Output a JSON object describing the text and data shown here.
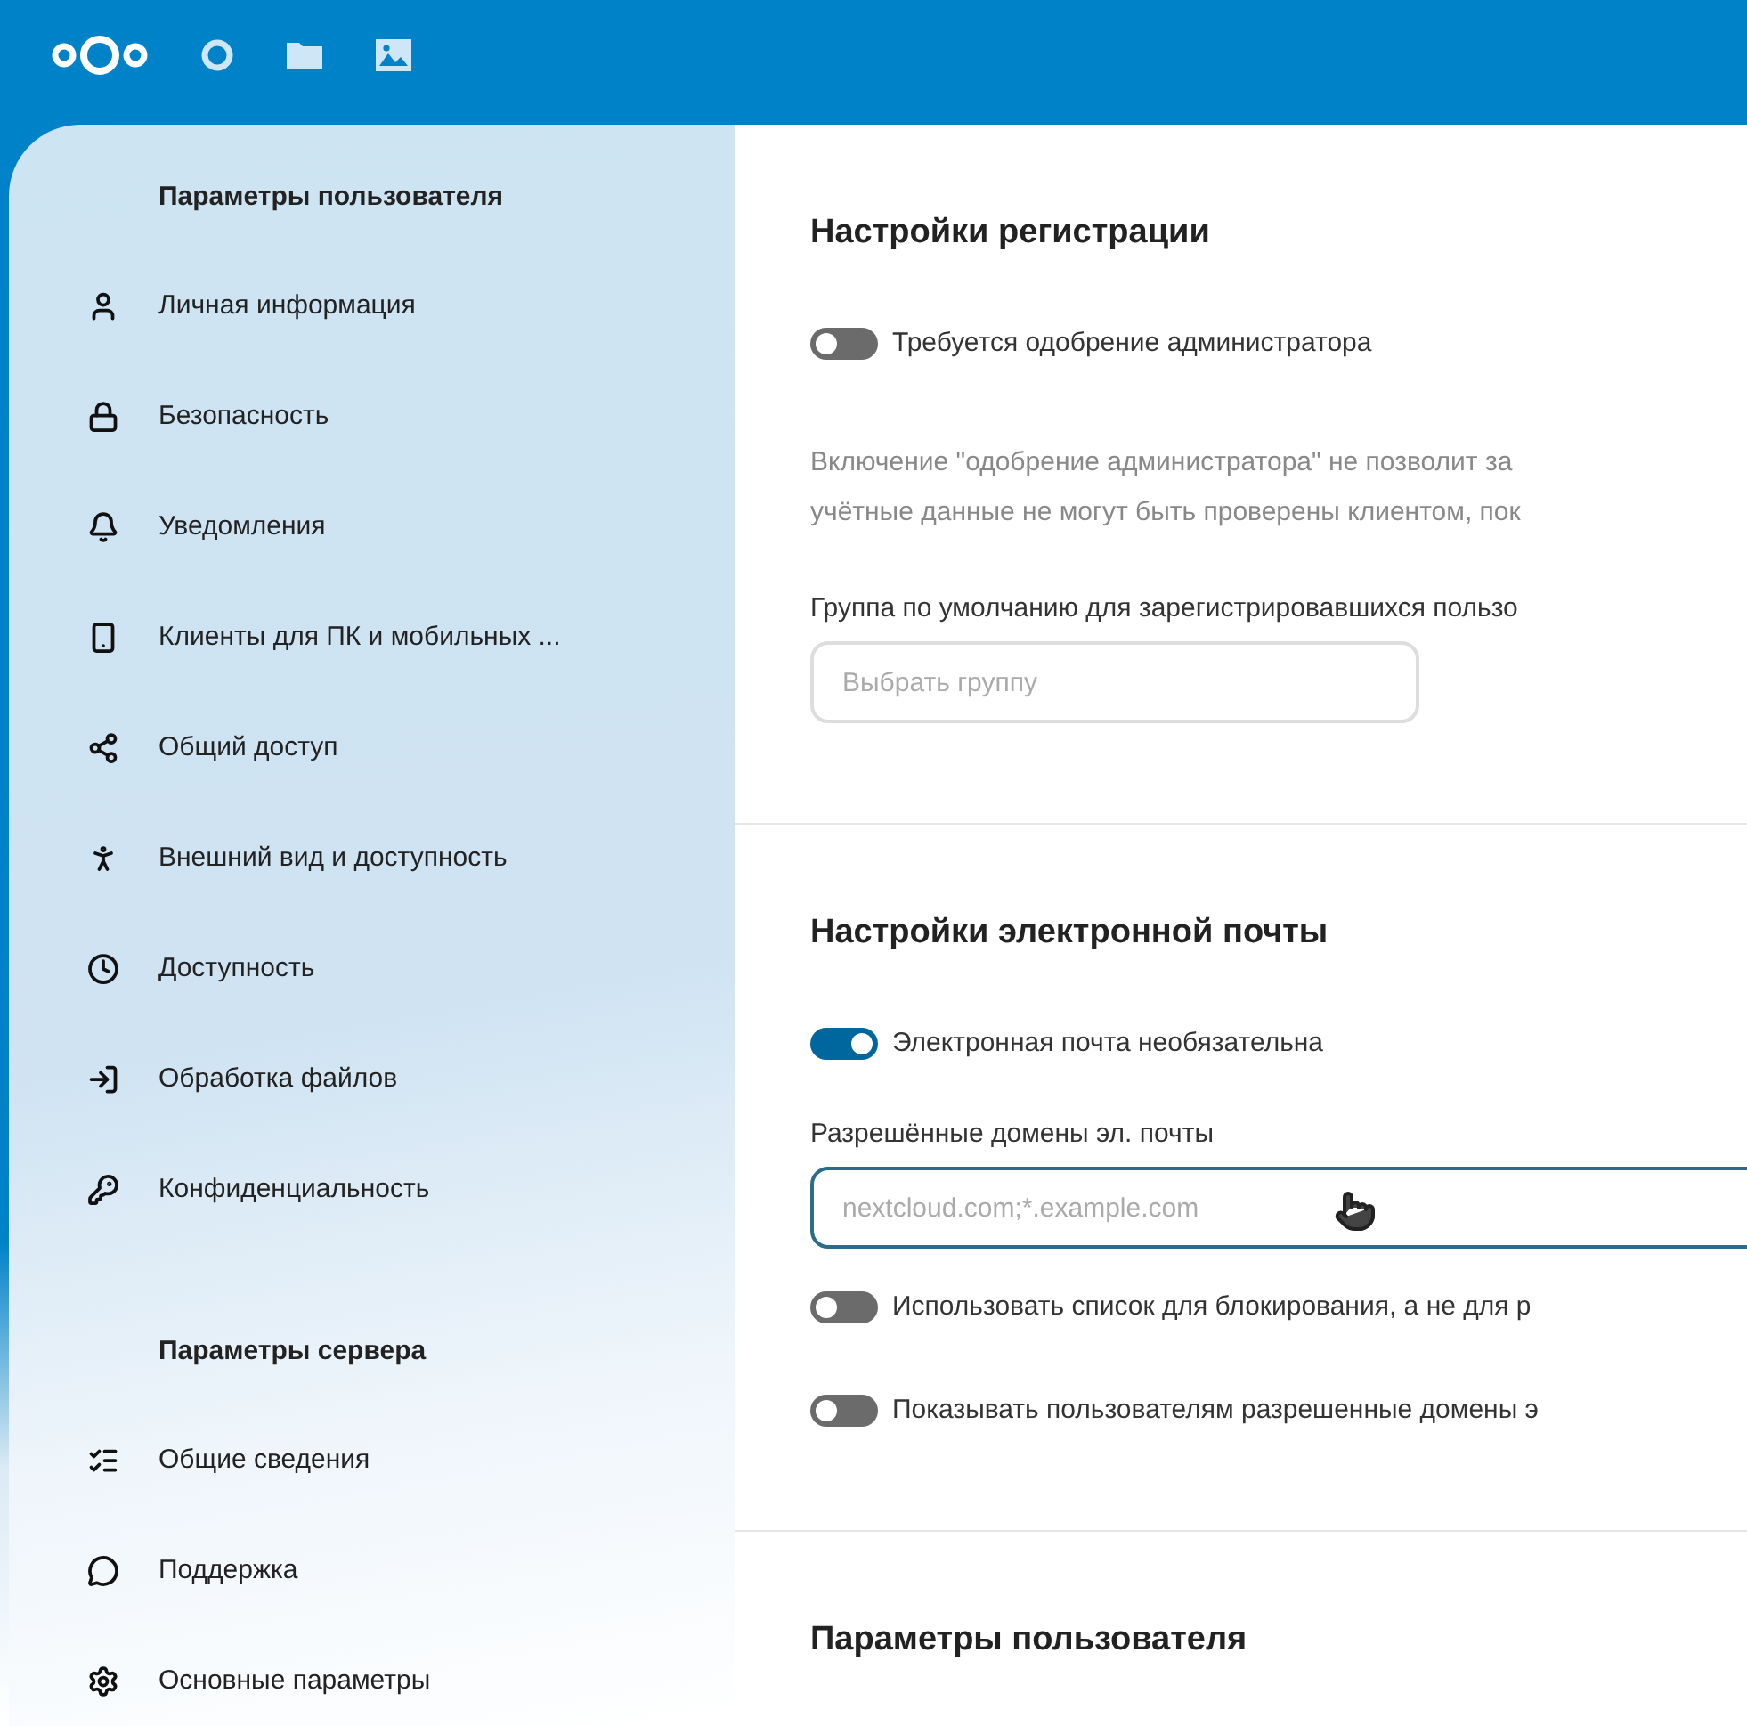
{
  "header": {
    "apps": [
      {
        "kind": "dashboard"
      },
      {
        "kind": "files"
      },
      {
        "kind": "photos"
      }
    ]
  },
  "sidebar": {
    "sections": [
      {
        "title": "Параметры пользователя",
        "items": [
          {
            "label": "Личная информация"
          },
          {
            "label": "Безопасность"
          },
          {
            "label": "Уведомления"
          },
          {
            "label": "Клиенты для ПК и мобильных ..."
          },
          {
            "label": "Общий доступ"
          },
          {
            "label": "Внешний вид и доступность"
          },
          {
            "label": "Доступность"
          },
          {
            "label": "Обработка файлов"
          },
          {
            "label": "Конфиденциальность"
          }
        ]
      },
      {
        "title": "Параметры сервера",
        "items": [
          {
            "label": "Общие сведения"
          },
          {
            "label": "Поддержка"
          },
          {
            "label": "Основные параметры"
          }
        ]
      }
    ]
  },
  "sections": [
    {
      "title": "Настройки регистрации",
      "blocks": [
        {
          "kind": "toggle",
          "label": "Требуется одобрение администратора",
          "on": false
        },
        {
          "kind": "note",
          "lines": [
            "Включение \"одобрение администратора\" не позволит за",
            "учётные данные не могут быть проверены клиентом, пок"
          ]
        },
        {
          "kind": "select",
          "label": "Группа по умолчанию для зарегистрировавшихся пользо",
          "placeholder": "Выбрать группу"
        }
      ]
    },
    {
      "title": "Настройки электронной почты",
      "blocks": [
        {
          "kind": "toggle",
          "label": "Электронная почта необязательна",
          "on": true
        },
        {
          "kind": "text_input",
          "label": "Разрешённые домены эл. почты",
          "placeholder": "nextcloud.com;*.example.com"
        },
        {
          "kind": "toggle",
          "label": "Использовать список для блокирования, а не для р",
          "on": false
        },
        {
          "kind": "toggle",
          "label": "Показывать пользователям разрешенные домены э",
          "on": false
        }
      ]
    },
    {
      "title": "Параметры пользователя"
    }
  ]
}
